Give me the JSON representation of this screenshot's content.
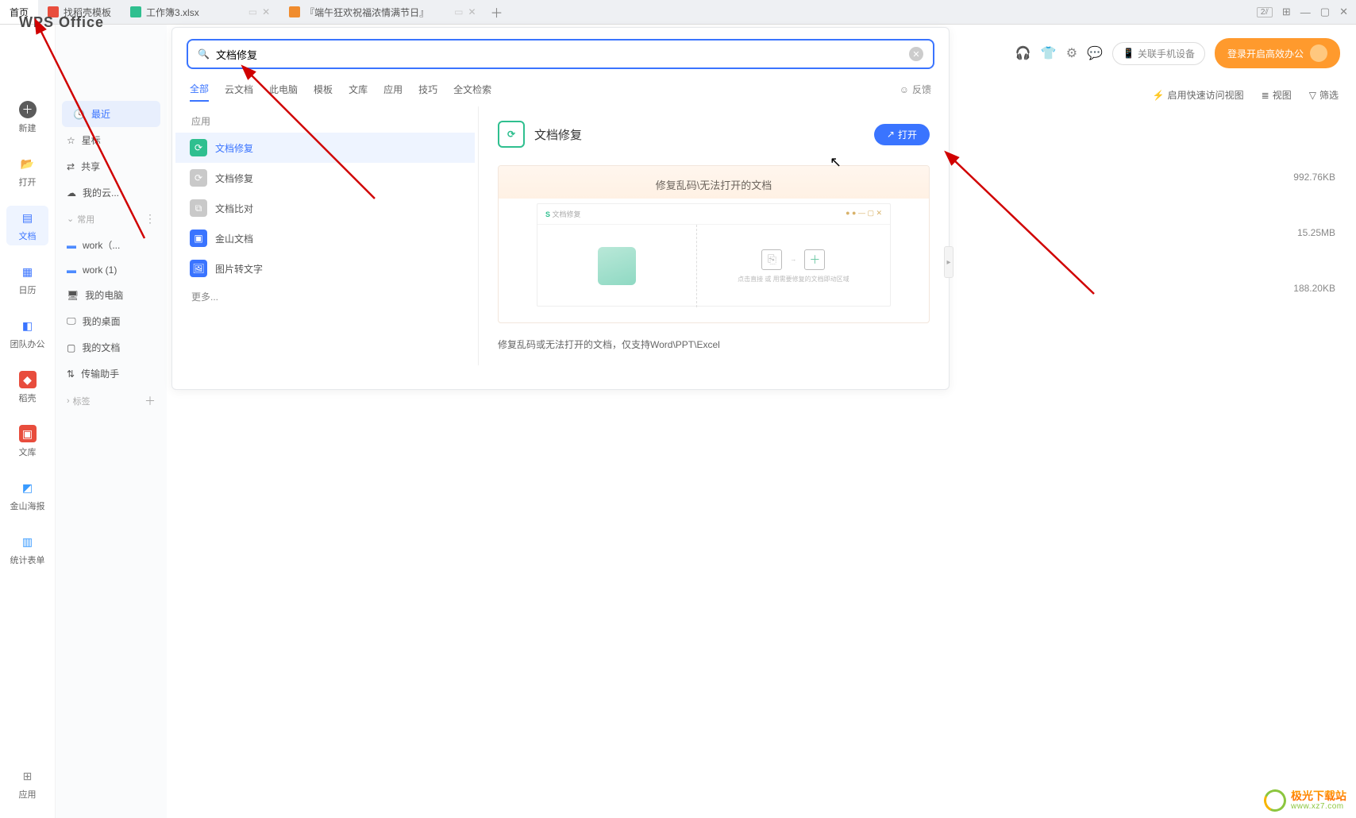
{
  "tabs": {
    "home": "首页",
    "t1": "找稻壳模板",
    "t2": "工作簿3.xlsx",
    "t3": "『端午狂欢祝福浓情满节日』"
  },
  "brand": "WPS Office",
  "leftRail": {
    "new": "新建",
    "open": "打开",
    "docs": "文档",
    "calendar": "日历",
    "team": "团队办公",
    "rice": "稻壳",
    "library": "文库",
    "poster": "金山海报",
    "form": "统计表单",
    "apps": "应用"
  },
  "sidebar": {
    "recent": "最近",
    "star": "星标",
    "share": "共享",
    "mycloud": "我的云...",
    "sectionCommon": "常用",
    "work1": "work（...",
    "work2": "work (1)",
    "mycomputer": "我的电脑",
    "mydesktop": "我的桌面",
    "mydocs": "我的文档",
    "transfer": "传输助手",
    "sectionTags": "标签"
  },
  "topbar": {
    "linkDevice": "关联手机设备",
    "login": "登录开启高效办公"
  },
  "actionRow": {
    "quickview": "启用快速访问视图",
    "listview": "视图",
    "filter": "筛选"
  },
  "fileSizes": {
    "f1": "992.76KB",
    "f2": "15.25MB",
    "f3": "188.20KB"
  },
  "search": {
    "query": "文档修复",
    "tabs": {
      "all": "全部",
      "cloud": "云文档",
      "local": "此电脑",
      "template": "模板",
      "library": "文库",
      "apps": "应用",
      "tips": "技巧",
      "fulltext": "全文检索"
    },
    "feedback": "反馈",
    "sectionApps": "应用",
    "results": {
      "r1": "文档修复",
      "r2": "文档修复",
      "r3": "文档比对",
      "r4": "金山文档",
      "r5": "图片转文字"
    },
    "more": "更多...",
    "detail": {
      "title": "文档修复",
      "open": "打开",
      "previewHeadline": "修复乱码\\无法打开的文档",
      "previewBrand": "文档修复",
      "previewBoxText": "点击直接 或 用需要修复的文档即动区域",
      "desc": "修复乱码或无法打开的文档，仅支持Word\\PPT\\Excel"
    }
  },
  "watermark": {
    "line1": "极光下载站",
    "line2": "www.xz7.com"
  }
}
